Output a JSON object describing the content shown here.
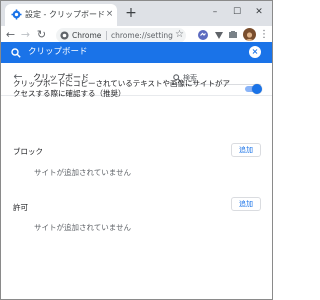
{
  "tab": {
    "title": "設定 - クリップボード",
    "close": "×"
  },
  "newtab": "+",
  "window_controls": {
    "minimize": "–",
    "maximize": "☐",
    "close": "✕"
  },
  "omnibox": {
    "scheme_label": "Chrome",
    "url": "chrome://settings/co..."
  },
  "settings_header": {
    "search_value": "クリップボード",
    "clear": "×"
  },
  "page": {
    "title": "クリップボード",
    "search_placeholder": "検索",
    "setting_description": "クリップボードにコピーされているテキストや画像にサイトがアクセスする際に確認する（推奨）",
    "toggle_on": true
  },
  "block": {
    "label": "ブロック",
    "add_button": "追加",
    "empty": "サイトが追加されていません"
  },
  "allow": {
    "label": "許可",
    "add_button": "追加",
    "empty": "サイトが追加されていません"
  },
  "colors": {
    "accent": "#1a73e8",
    "toggle_track": "#8ab4f8",
    "tab_strip": "#dee1e6"
  },
  "icons": [
    "settings-gear-icon",
    "back-icon",
    "forward-icon",
    "reload-icon",
    "chrome-site-icon",
    "star-icon",
    "extension-icon",
    "avatar",
    "menu-icon",
    "search-icon",
    "close-icon"
  ]
}
